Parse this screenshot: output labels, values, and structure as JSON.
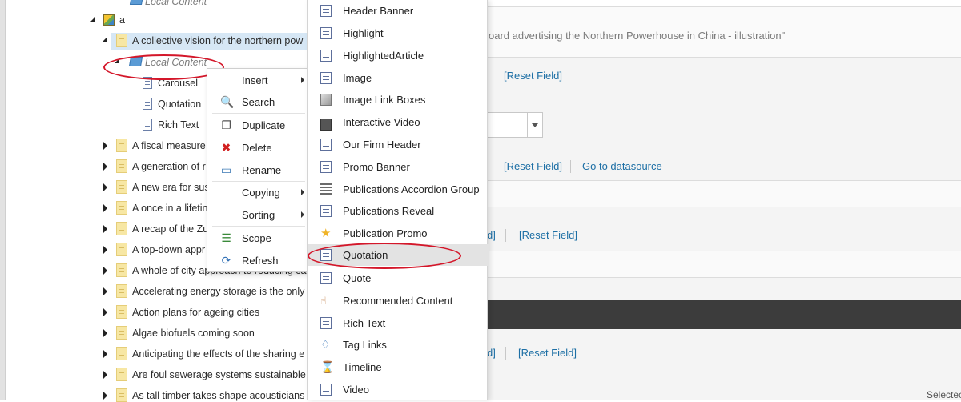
{
  "tree": {
    "top_item": "Local Content",
    "root_item": "a",
    "selected_item": "A collective vision for the northern pow",
    "local_content": "Local Content",
    "children": [
      "Carousel",
      "Quotation",
      "Rich Text"
    ],
    "items": [
      "A fiscal measure",
      "A generation of r",
      "A new era for sus",
      "A once in a lifetin",
      "A recap of the Zu",
      "A top-down appr",
      "A whole of city approach to reducing ca",
      "Accelerating energy storage is the only",
      "Action plans for ageing cities",
      "Algae biofuels coming soon",
      "Anticipating the effects of the sharing e",
      "Are foul sewerage systems sustainable",
      "As tall timber takes shape acousticians"
    ]
  },
  "context_menu": {
    "items": [
      {
        "label": "Insert",
        "icon": "none"
      },
      {
        "label": "Search",
        "icon": "search-icon"
      },
      {
        "label": "Duplicate",
        "icon": "duplicate-icon"
      },
      {
        "label": "Delete",
        "icon": "delete-icon"
      },
      {
        "label": "Rename",
        "icon": "rename-icon"
      },
      {
        "label": "Copying",
        "icon": "none"
      },
      {
        "label": "Sorting",
        "icon": "none"
      },
      {
        "label": "Scope",
        "icon": "scope-icon"
      },
      {
        "label": "Refresh",
        "icon": "refresh-icon"
      }
    ]
  },
  "insert_menu": {
    "items": [
      "Header Banner",
      "Highlight",
      "HighlightedArticle",
      "Image",
      "Image Link Boxes",
      "Interactive Video",
      "Our Firm Header",
      "Promo Banner",
      "Publications Accordion Group",
      "Publications Reveal",
      "Publication Promo",
      "Quotation",
      "Quote",
      "Recommended Content",
      "Rich Text",
      "Tag Links",
      "Timeline",
      "Video"
    ],
    "hovered": "Quotation"
  },
  "editor": {
    "caption_text": "oard advertising the Northern Powerhouse in China - illustration\"",
    "reset_field": "[Reset Field]",
    "go_to_datasource": "Go to datasource",
    "fragment_bracket": "d]",
    "selected_label": "Selectec"
  },
  "colors": {
    "link": "#1d6fa5",
    "annotation": "#d4172a",
    "selection": "#d6e7f5",
    "hover": "#e3e3e3"
  }
}
